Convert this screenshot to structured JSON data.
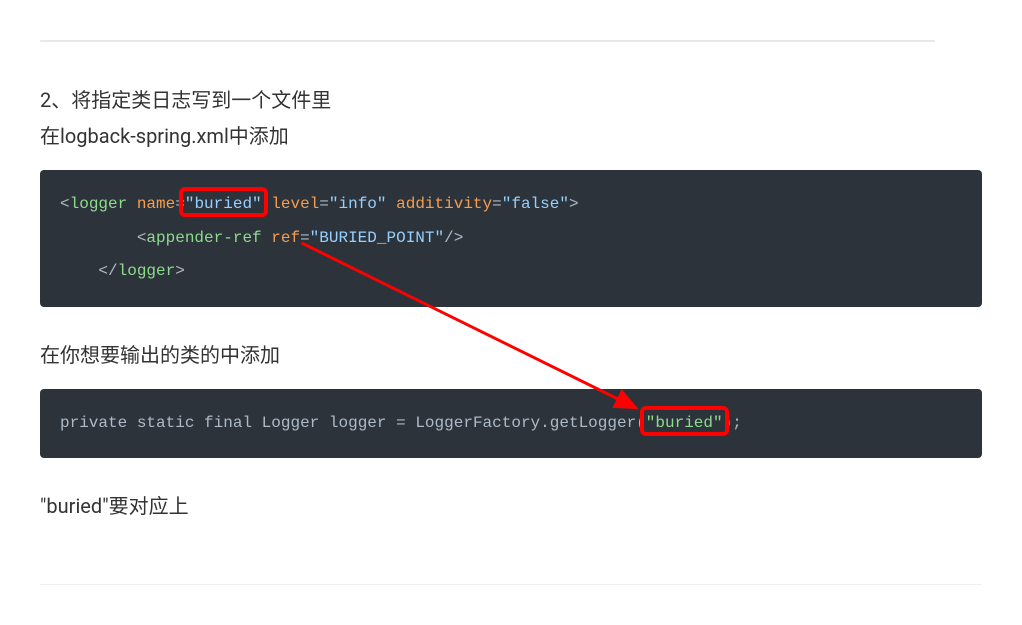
{
  "top_bar": "",
  "para1_line1": "2、将指定类日志写到一个文件里",
  "para1_line2": "在logback-spring.xml中添加",
  "code1": {
    "p1": "<",
    "tag1": "logger",
    "sp1": " ",
    "attr1": "name",
    "eq1": "=",
    "val1": "\"buried\"",
    "sp2": " ",
    "attr2": "level",
    "eq2": "=",
    "val2": "\"info\"",
    "sp3": " ",
    "attr3": "additivity",
    "eq3": "=",
    "val3": "\"false\"",
    "p2": ">",
    "indent2": "        ",
    "p3": "<",
    "tag2": "appender-ref",
    "sp4": " ",
    "attr4": "ref",
    "eq4": "=",
    "val4": "\"BURIED_POINT\"",
    "p4": "/>",
    "indent3": "    ",
    "p5": "</",
    "tag3": "logger",
    "p6": ">"
  },
  "para2": "在你想要输出的类的中添加",
  "code2": {
    "kw1": "private",
    "sp1": " ",
    "kw2": "static",
    "sp2": " ",
    "kw3": "final",
    "sp3": " ",
    "type1": "Logger",
    "sp4": " ",
    "var1": "logger",
    "sp5": " ",
    "eq": "=",
    "sp6": " ",
    "type2": "LoggerFactory",
    "dot": ".",
    "method": "getLogger",
    "p1": "(",
    "str1": "\"buried\"",
    "p2": ")",
    "semi": ";"
  },
  "para3": "\"buried\"要对应上"
}
